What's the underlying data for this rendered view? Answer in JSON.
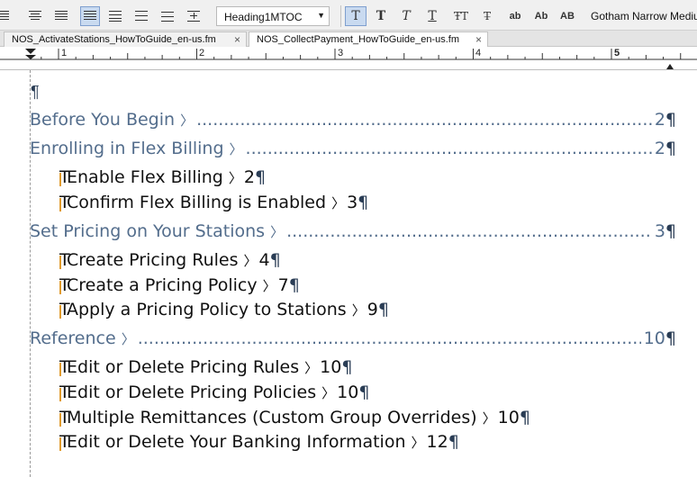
{
  "toolbar": {
    "paragraph_format": "Heading1MTOC",
    "font_name": "Gotham Narrow Medium",
    "format_buttons": [
      "T",
      "T",
      "T",
      "T",
      "ŦT",
      "T̶",
      "ab",
      "Ab",
      "AB"
    ]
  },
  "tabs": [
    {
      "label": "NOS_ActivateStations_HowToGuide_en-us.fm",
      "close": "×"
    },
    {
      "label": "NOS_CollectPayment_HowToGuide_en-us.fm",
      "close": "×"
    }
  ],
  "ruler": {
    "labels": [
      "1",
      "2",
      "3",
      "4",
      "5"
    ]
  },
  "document": {
    "empty_line": "¶",
    "toc": [
      {
        "level": 1,
        "title": "Before You Begin",
        "page": "2"
      },
      {
        "level": 1,
        "title": "Enrolling in Flex Billing",
        "page": "2"
      },
      {
        "level": 2,
        "title": "Enable Flex Billing",
        "page": "2"
      },
      {
        "level": 2,
        "title": "Confirm Flex Billing is Enabled",
        "page": "3"
      },
      {
        "level": 1,
        "title": "Set Pricing on Your Stations",
        "page": "3"
      },
      {
        "level": 2,
        "title": "Create Pricing Rules",
        "page": "4"
      },
      {
        "level": 2,
        "title": "Create a Pricing Policy",
        "page": "7"
      },
      {
        "level": 2,
        "title": "Apply a Pricing Policy to Stations",
        "page": "9"
      },
      {
        "level": 1,
        "title": "Reference",
        "page": "10"
      },
      {
        "level": 2,
        "title": "Edit or Delete Pricing Rules",
        "page": "10"
      },
      {
        "level": 2,
        "title": "Edit or Delete Pricing Policies",
        "page": "10"
      },
      {
        "level": 2,
        "title": "Multiple Remittances (Custom Group Overrides)",
        "page": "10"
      },
      {
        "level": 2,
        "title": "Edit or Delete Your Banking Information",
        "page": "12"
      }
    ],
    "tab_symbol": "〉",
    "pilcrow": "¶",
    "t_marker": "T"
  }
}
